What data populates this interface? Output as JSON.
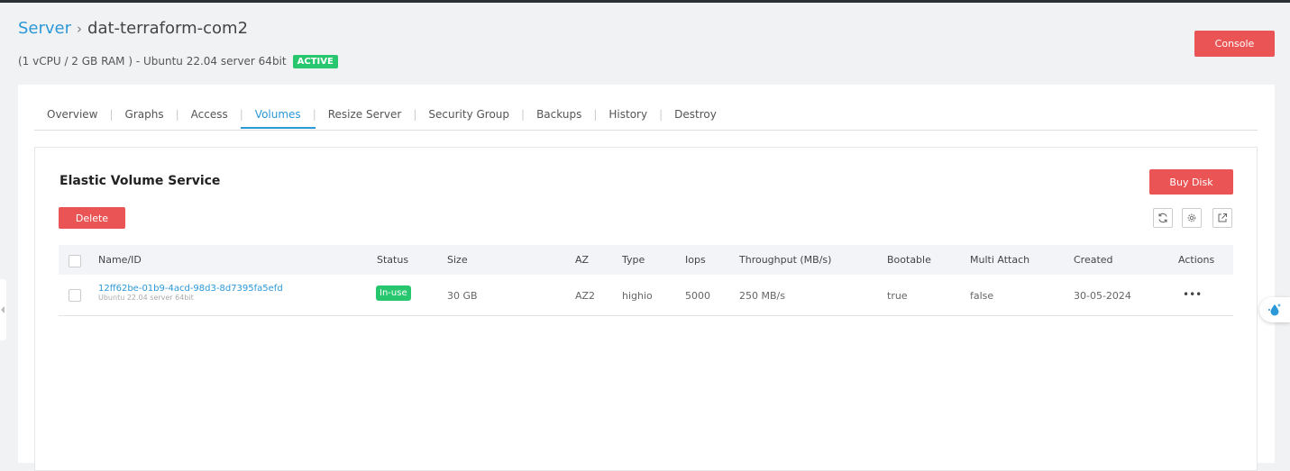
{
  "header": {
    "breadcrumb_root": "Server",
    "separator": "›",
    "server_name": "dat-terraform-com2",
    "spec_text": "(1 vCPU / 2 GB RAM ) - Ubuntu 22.04 server 64bit",
    "status_badge": "ACTIVE",
    "console_label": "Console"
  },
  "tabs": [
    {
      "label": "Overview",
      "active": false
    },
    {
      "label": "Graphs",
      "active": false
    },
    {
      "label": "Access",
      "active": false
    },
    {
      "label": "Volumes",
      "active": true
    },
    {
      "label": "Resize Server",
      "active": false
    },
    {
      "label": "Security Group",
      "active": false
    },
    {
      "label": "Backups",
      "active": false
    },
    {
      "label": "History",
      "active": false
    },
    {
      "label": "Destroy",
      "active": false
    }
  ],
  "volumes": {
    "section_title": "Elastic Volume Service",
    "buy_disk_label": "Buy Disk",
    "delete_label": "Delete",
    "toolbar_icons": [
      "refresh-icon",
      "gear-icon",
      "external-link-icon"
    ],
    "columns": [
      "Name/ID",
      "Status",
      "Size",
      "AZ",
      "Type",
      "Iops",
      "Throughput (MB/s)",
      "Bootable",
      "Multi Attach",
      "Created",
      "Actions"
    ],
    "rows": [
      {
        "id": "12ff62be-01b9-4acd-98d3-8d7395fa5efd",
        "os": "Ubuntu 22.04 server 64bit",
        "status": "In-use",
        "size": "30 GB",
        "az": "AZ2",
        "type": "highio",
        "iops": "5000",
        "throughput": "250 MB/s",
        "bootable": "true",
        "multi_attach": "false",
        "created": "30-05-2024",
        "actions": "•••"
      }
    ]
  },
  "colors": {
    "accent": "#2b98d8",
    "danger": "#ea5455",
    "success": "#28c76f"
  }
}
